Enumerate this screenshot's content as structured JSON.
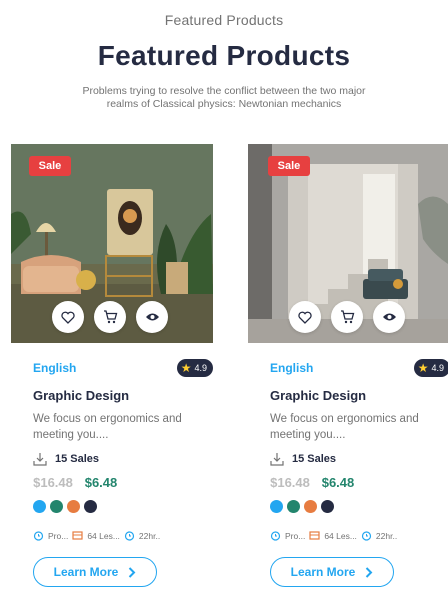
{
  "header": {
    "eyebrow": "Featured Products",
    "title": "Featured Products",
    "subtitle": "Problems trying to resolve the conflict between the two major realms of Classical physics: Newtonian mechanics"
  },
  "colors": {
    "primary": "#23A6F0",
    "sale": "#E74040",
    "dark": "#252B42",
    "price_new": "#23856D",
    "price_old": "#BDBDBD",
    "swatches": [
      "#23A6F0",
      "#23856D",
      "#E77C40",
      "#252B42"
    ]
  },
  "cards": [
    {
      "sale_badge": "Sale",
      "category": "English",
      "rating": "4.9",
      "name": "Graphic Design",
      "description": "We focus on ergonomics and meeting you....",
      "sales": "15 Sales",
      "price_old": "$16.48",
      "price_new": "$6.48",
      "meta": [
        "Pro...",
        "64 Les...",
        "22hr.."
      ],
      "button": "Learn More",
      "image": "living-room-interior"
    },
    {
      "sale_badge": "Sale",
      "category": "English",
      "rating": "4.9",
      "name": "Graphic Design",
      "description": "We focus on ergonomics and meeting you....",
      "sales": "15 Sales",
      "price_old": "$16.48",
      "price_new": "$6.48",
      "meta": [
        "Pro...",
        "64 Les...",
        "22hr.."
      ],
      "button": "Learn More",
      "image": "staircase-interior"
    }
  ]
}
